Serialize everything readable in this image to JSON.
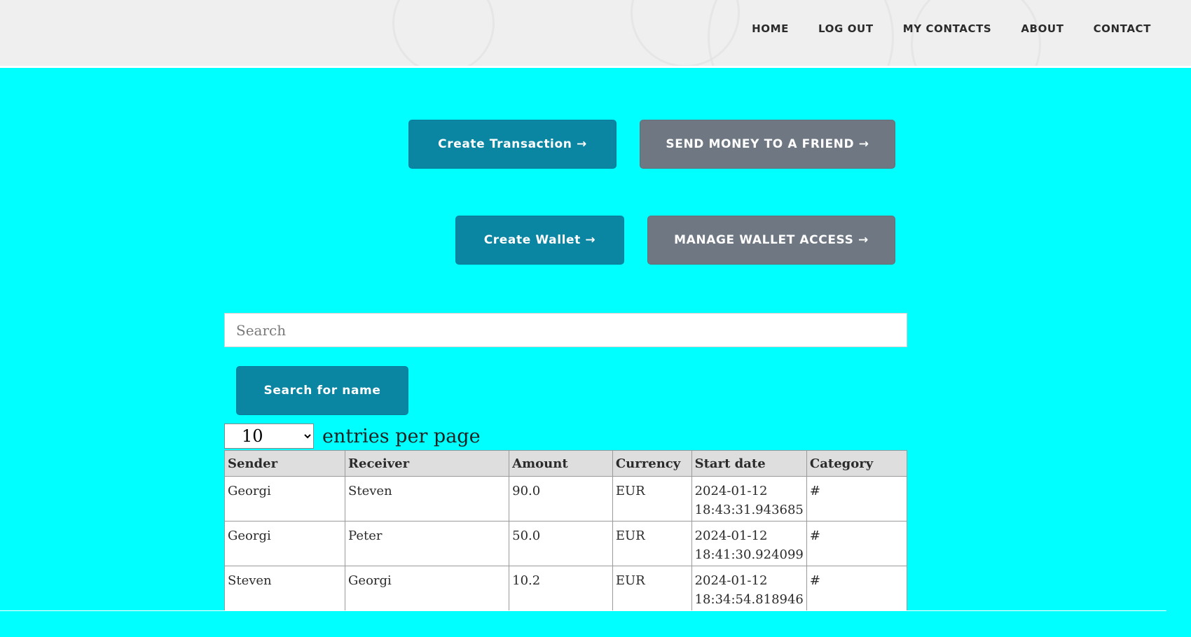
{
  "nav": {
    "items": [
      {
        "label": "HOME"
      },
      {
        "label": "LOG OUT"
      },
      {
        "label": "MY CONTACTS"
      },
      {
        "label": "ABOUT"
      },
      {
        "label": "CONTACT"
      }
    ]
  },
  "actions": {
    "create_transaction": "Create Transaction →",
    "send_money": "SEND MONEY TO A FRIEND →",
    "create_wallet": "Create Wallet →",
    "manage_wallet": "MANAGE WALLET ACCESS →"
  },
  "search": {
    "placeholder": "Search",
    "value": "",
    "button_label": "Search for name"
  },
  "pagination": {
    "selected": "10",
    "label": "entries per page"
  },
  "table": {
    "headers": [
      "Sender",
      "Receiver",
      "Amount",
      "Currency",
      "Start date",
      "Category"
    ],
    "rows": [
      {
        "sender": "Georgi",
        "receiver": "Steven",
        "amount": "90.0",
        "currency": "EUR",
        "date": "2024-01-12",
        "time": "18:43:31.943685",
        "category": "#"
      },
      {
        "sender": "Georgi",
        "receiver": "Peter",
        "amount": "50.0",
        "currency": "EUR",
        "date": "2024-01-12",
        "time": "18:41:30.924099",
        "category": "#"
      },
      {
        "sender": "Steven",
        "receiver": "Georgi",
        "amount": "10.2",
        "currency": "EUR",
        "date": "2024-01-12",
        "time": "18:34:54.818946",
        "category": "#"
      }
    ]
  },
  "colors": {
    "background": "#00ffff",
    "primary_button": "#0a86a3",
    "secondary_button": "#6e7782",
    "header": "#efefef"
  }
}
